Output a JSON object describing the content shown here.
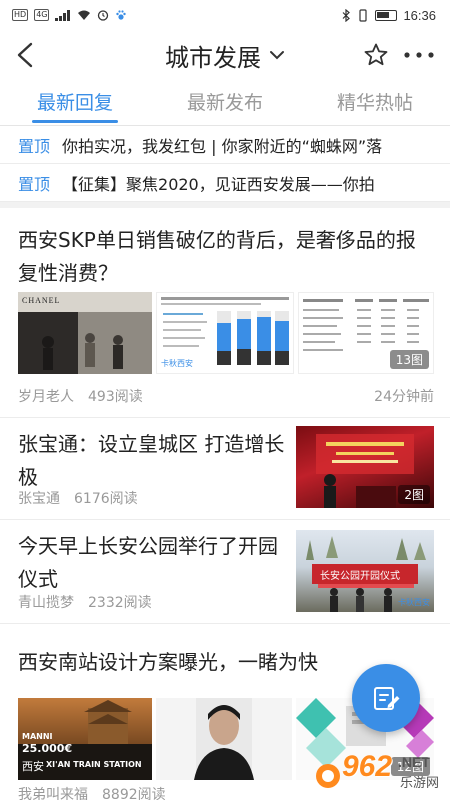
{
  "status_bar": {
    "left_tags": [
      "HD",
      "4G"
    ],
    "time": "16:36"
  },
  "header": {
    "title": "城市发展",
    "back_icon": "chevron-left-icon",
    "dropdown_icon": "chevron-down-icon",
    "favorite_icon": "star-icon",
    "more_icon": "more-dots-icon"
  },
  "tabs": [
    {
      "label": "最新回复",
      "active": true
    },
    {
      "label": "最新发布",
      "active": false
    },
    {
      "label": "精华热帖",
      "active": false
    }
  ],
  "pinned": [
    {
      "tag": "置顶",
      "text": "你拍实况，我发红包 | 你家附近的“蜘蛛网”落"
    },
    {
      "tag": "置顶",
      "text": "【征集】聚焦2020，见证西安发展——你拍"
    }
  ],
  "articles": [
    {
      "title": "西安SKP单日销售破亿的背后，是奢侈品的报复性消费？",
      "author": "岁月老人",
      "reads": "493阅读",
      "time": "24分钟前",
      "image_count": "13图",
      "thumb_text": [
        "CHANEL",
        "卡秋西安"
      ]
    },
    {
      "title": "张宝通：设立皇城区 打造增长极",
      "author": "张宝通",
      "reads": "6176阅读",
      "image_count": "2图"
    },
    {
      "title": "今天早上长安公园举行了开园仪式",
      "author": "青山揽梦",
      "reads": "2332阅读",
      "thumb_text": [
        "长安公园开园仪式",
        "卡秋西安"
      ]
    },
    {
      "title": "西安南站设计方案曝光，一睹为快",
      "author": "我弟叫来福",
      "reads": "8892阅读",
      "image_count": "12图",
      "thumb_text": [
        "MANNI",
        "25.000€",
        "西安",
        "XI'AN TRAIN STATION"
      ]
    }
  ],
  "fab": {
    "icon": "edit-post-icon"
  },
  "watermark": {
    "brand": "962",
    "suffix": ".NET",
    "subtitle": "乐游网"
  },
  "colors": {
    "accent": "#3a8ee6",
    "meta": "#999999",
    "text": "#222222"
  }
}
